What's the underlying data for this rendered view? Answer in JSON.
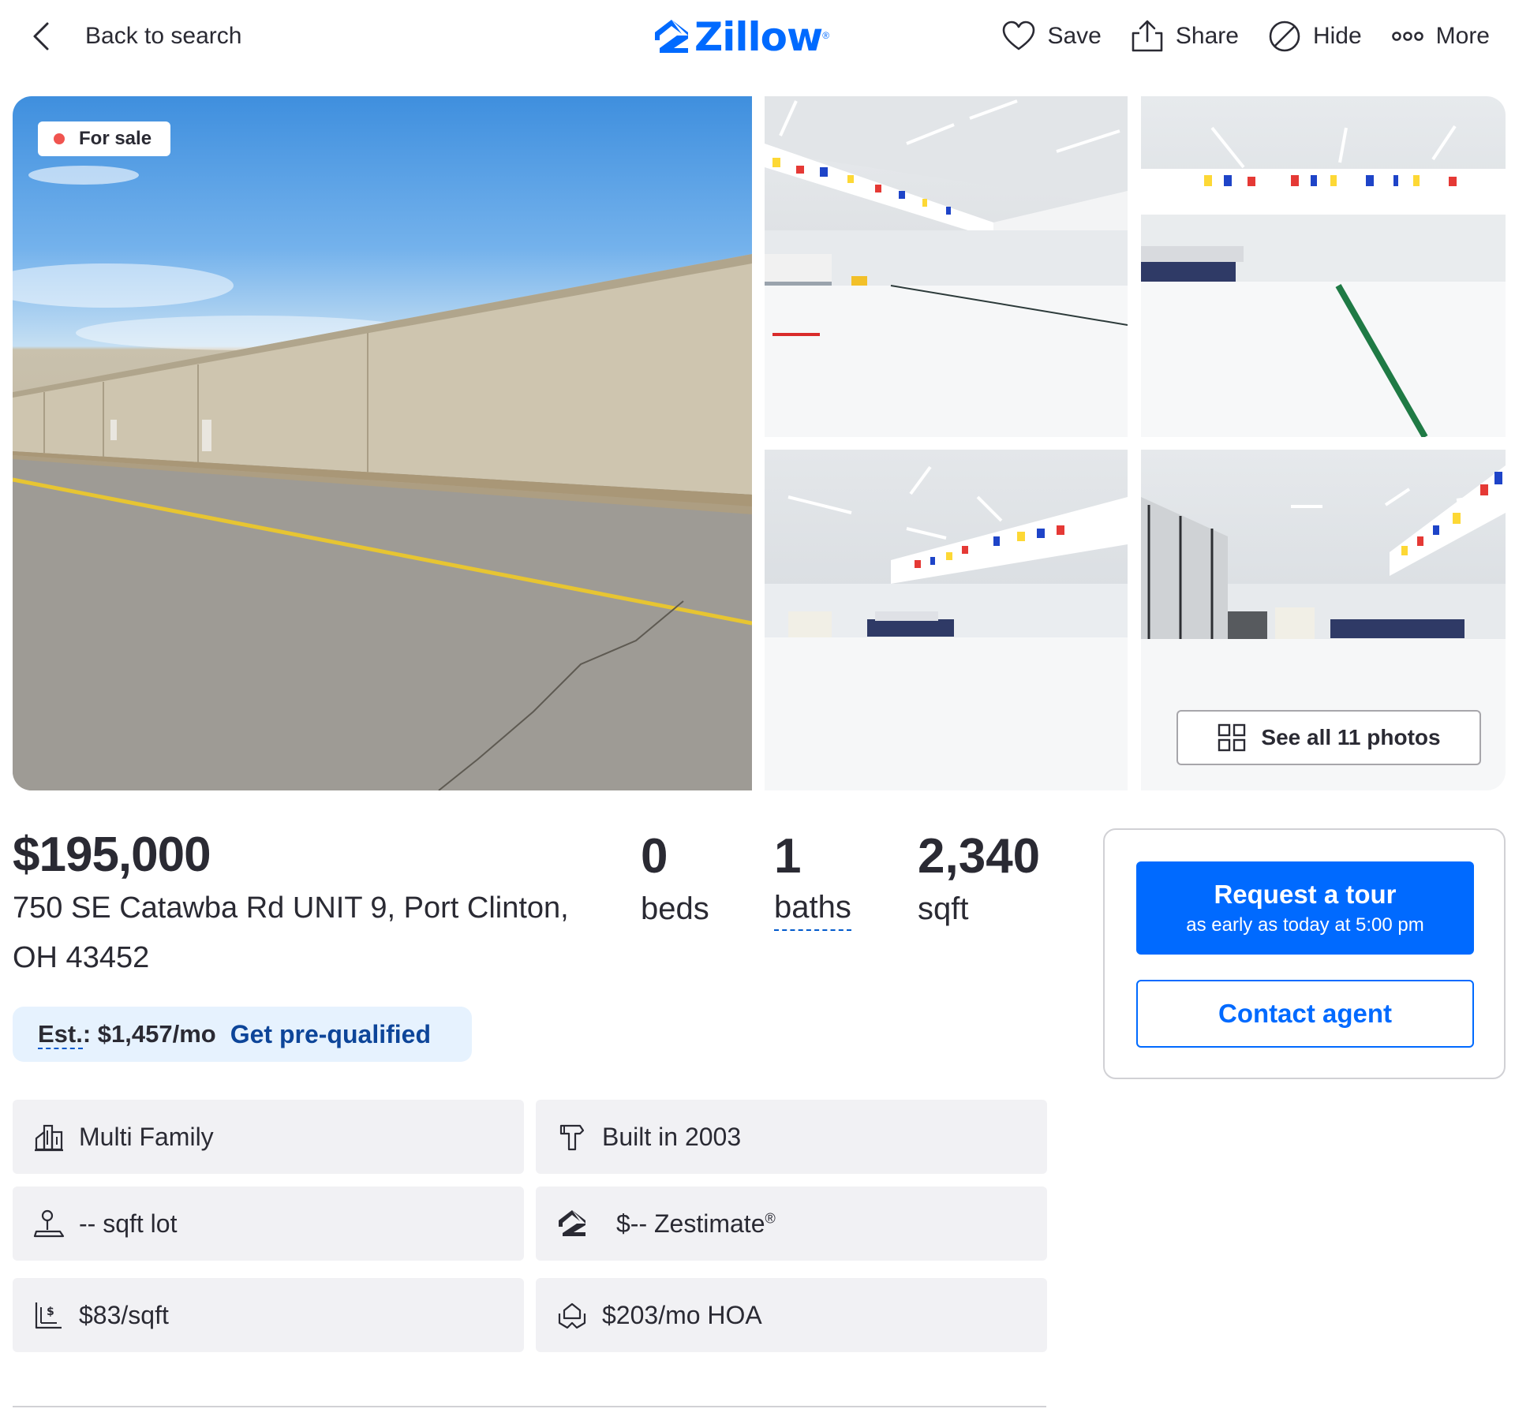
{
  "header": {
    "back_label": "Back to search",
    "logo_text": "Zillow",
    "logo_reg": "®",
    "actions": [
      {
        "label": "Save",
        "icon": "heart-icon"
      },
      {
        "label": "Share",
        "icon": "share-icon"
      },
      {
        "label": "Hide",
        "icon": "hide-icon"
      },
      {
        "label": "More",
        "icon": "more-icon"
      }
    ]
  },
  "gallery": {
    "status_badge": "For sale",
    "see_all_label": "See all 11 photos",
    "photos": [
      "hangar-exterior-photo",
      "hangar-interior-photo-1",
      "hangar-interior-photo-2",
      "hangar-interior-photo-3",
      "hangar-interior-photo-4"
    ]
  },
  "listing": {
    "price": "$195,000",
    "address": "750 SE Catawba Rd UNIT 9, Port Clinton, OH 43452",
    "beds": {
      "value": "0",
      "label": "beds"
    },
    "baths": {
      "value": "1",
      "label": "baths"
    },
    "sqft": {
      "value": "2,340",
      "label": "sqft"
    }
  },
  "estimate": {
    "label_prefix": "Est.",
    "label_suffix": ": $1,457/mo",
    "link": "Get pre-qualified"
  },
  "facts": [
    {
      "text": "Multi Family",
      "icon": "building-icon"
    },
    {
      "text": "Built in 2003",
      "icon": "hammer-icon"
    },
    {
      "text": "-- sqft lot",
      "icon": "lot-icon"
    },
    {
      "text": "$-- Zestimate",
      "icon": "zestimate-icon",
      "sup": "®"
    },
    {
      "text": "$83/sqft",
      "icon": "price-per-sqft-icon"
    },
    {
      "text": "$203/mo HOA",
      "icon": "hoa-icon"
    }
  ],
  "contact": {
    "tour_title": "Request a tour",
    "tour_subtitle": "as early as today at 5:00 pm",
    "contact_label": "Contact agent"
  },
  "colors": {
    "brand": "#006aff",
    "text": "#2a2a33",
    "status_dot": "#f0544f",
    "fact_bg": "#f1f1f4",
    "estimate_bg": "#e6f2fe"
  }
}
